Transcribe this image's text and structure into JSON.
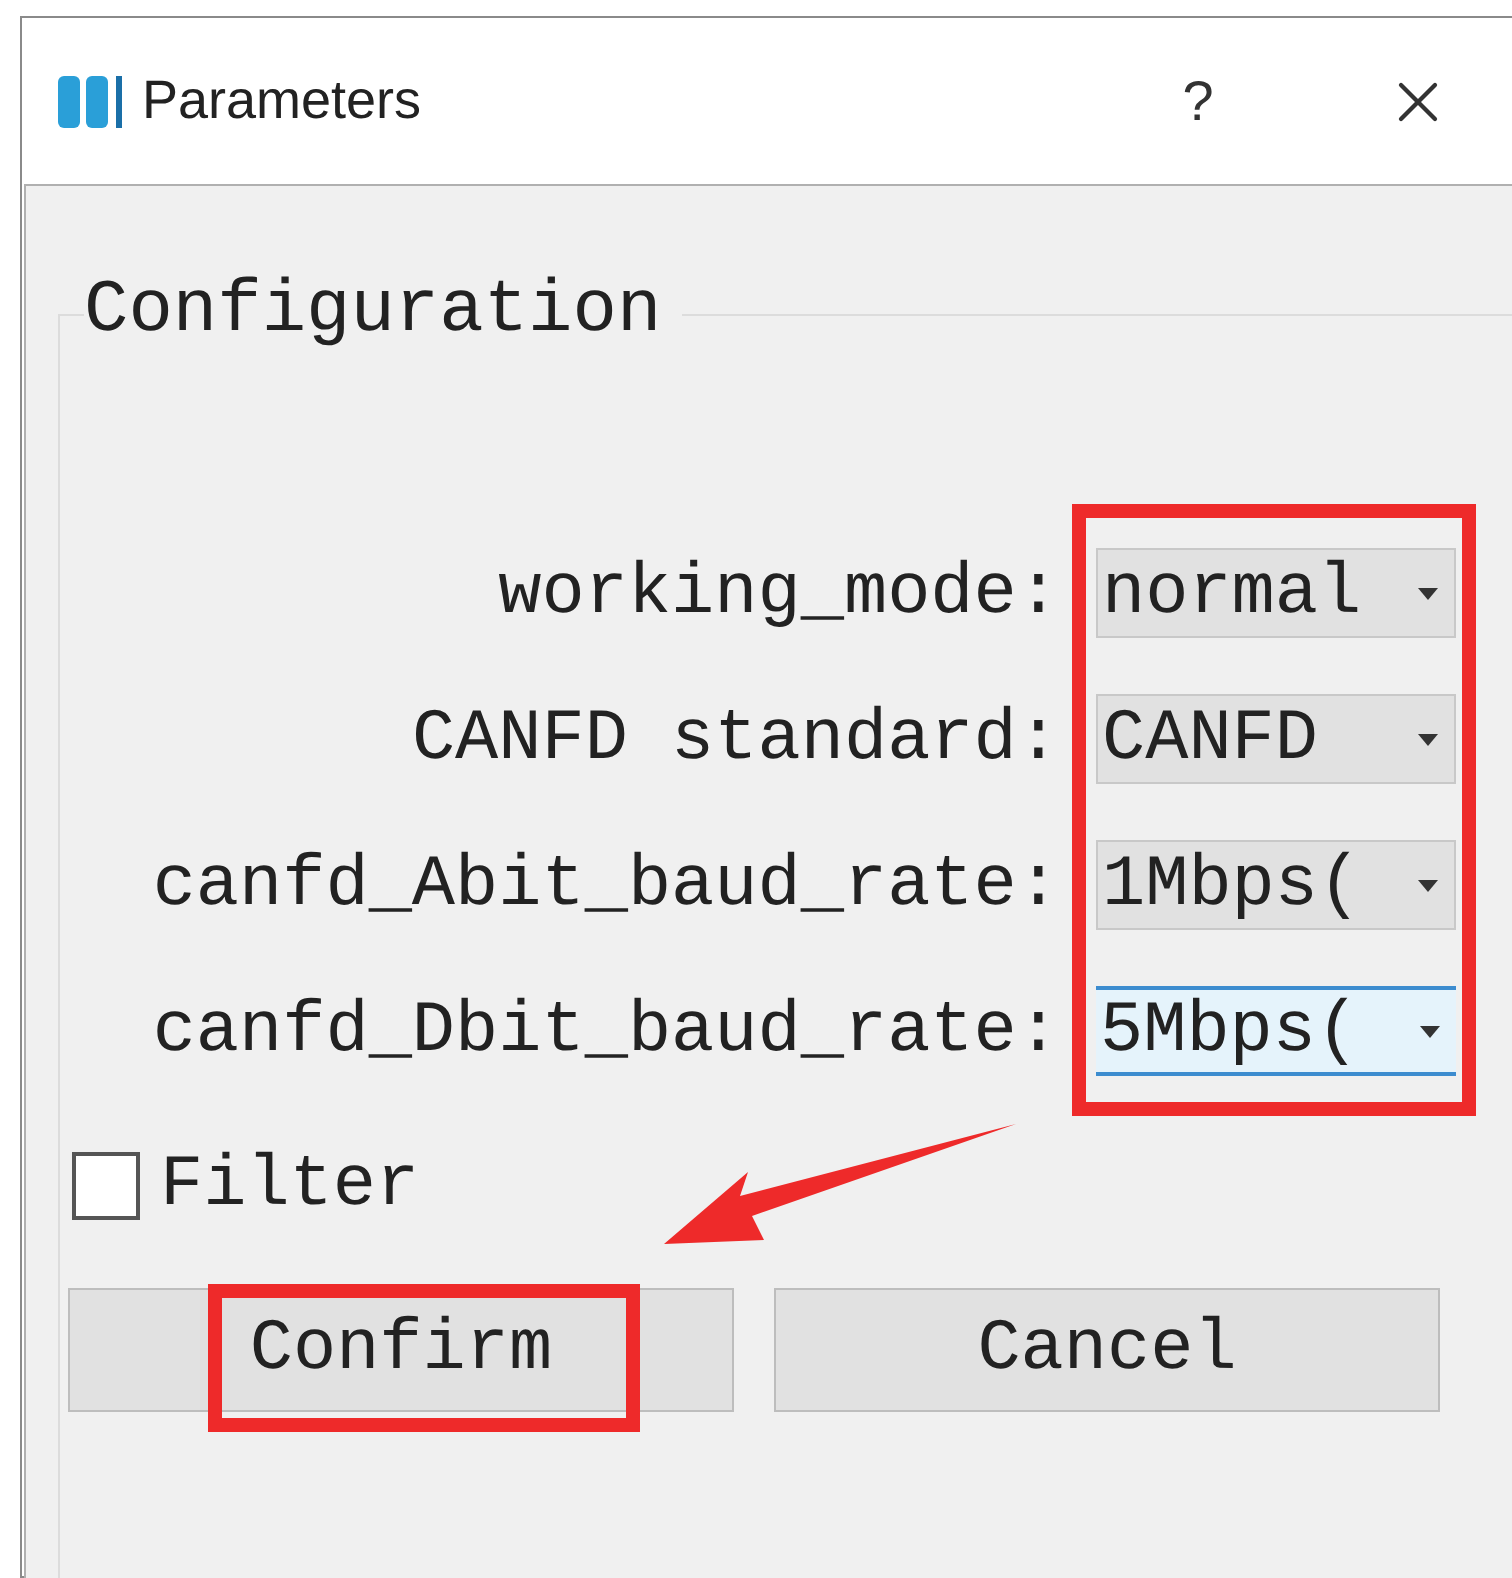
{
  "window": {
    "title": "Parameters",
    "help": "?"
  },
  "group": {
    "title": "Configuration"
  },
  "fields": [
    {
      "label": "working_mode:",
      "value": "normal",
      "focused": false
    },
    {
      "label": "CANFD standard:",
      "value": "CANFD",
      "focused": false
    },
    {
      "label": "canfd_Abit_baud_rate:",
      "value": "1Mbps(",
      "focused": false
    },
    {
      "label": "canfd_Dbit_baud_rate:",
      "value": "5Mbps(",
      "focused": true
    }
  ],
  "filter": {
    "label": "Filter",
    "checked": false
  },
  "buttons": [
    {
      "label": "Confirm",
      "highlighted": true
    },
    {
      "label": "Cancel",
      "highlighted": false
    }
  ]
}
